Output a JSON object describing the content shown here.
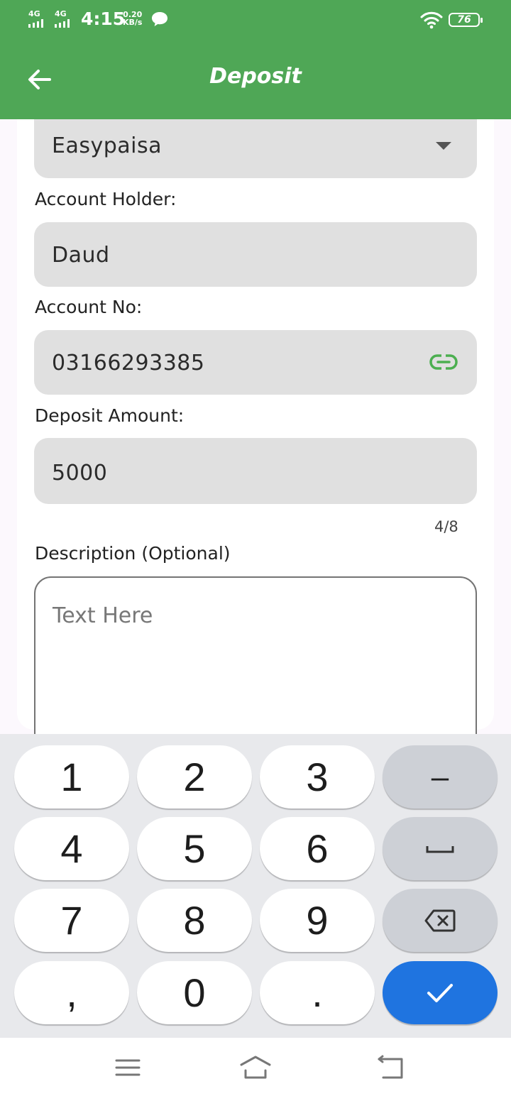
{
  "status_bar": {
    "net1": "4G",
    "net2": "4G",
    "time": "4:15",
    "speed_value": "0.20",
    "speed_unit": "KB/s",
    "battery": "76"
  },
  "header": {
    "title": "Deposit"
  },
  "form": {
    "method_value": "Easypaisa",
    "holder_label": "Account Holder:",
    "holder_value": "Daud",
    "account_label": "Account No:",
    "account_value": "03166293385",
    "amount_label": "Deposit Amount:",
    "amount_value": "5000",
    "amount_counter": "4/8",
    "description_label": "Description (Optional)",
    "description_placeholder": "Text Here"
  },
  "keyboard": {
    "rows": [
      [
        "1",
        "2",
        "3",
        "–"
      ],
      [
        "4",
        "5",
        "6",
        "space"
      ],
      [
        "7",
        "8",
        "9",
        "backspace"
      ],
      [
        ",",
        "0",
        ".",
        "done"
      ]
    ]
  },
  "colors": {
    "app_bar": "#4fa756",
    "accent_green": "#4caf50",
    "keyboard_done": "#1f74e0",
    "field_bg": "#e0e0e0"
  },
  "icons": {
    "back": "arrow-left-icon",
    "dropdown": "caret-down-icon",
    "account": "link-icon",
    "nav_menu": "menu-icon",
    "nav_home": "home-icon",
    "nav_back": "back-icon"
  }
}
